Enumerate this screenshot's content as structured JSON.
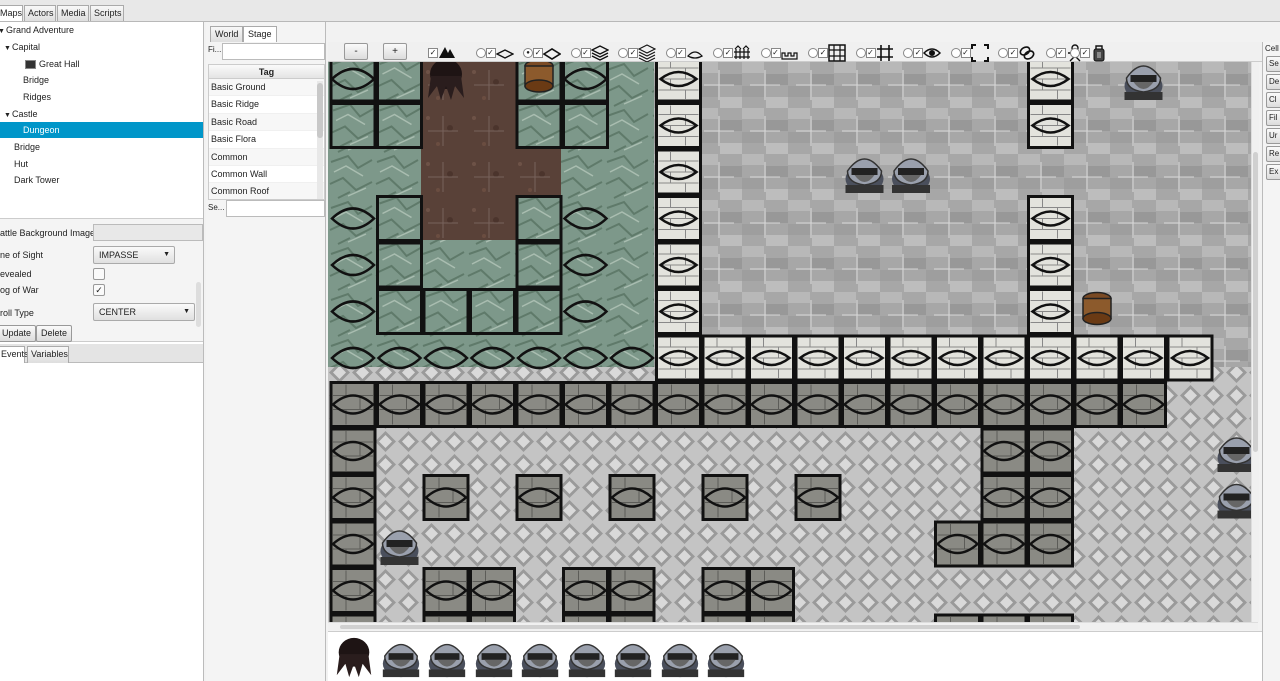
{
  "top_tabs": [
    {
      "label": "Maps",
      "active": true
    },
    {
      "label": "Actors",
      "active": false
    },
    {
      "label": "Media",
      "active": false
    },
    {
      "label": "Scripts",
      "active": false
    }
  ],
  "tree": {
    "root": "Grand Adventure",
    "items": [
      {
        "label": "Capital",
        "expandable": true,
        "expanded": true
      },
      {
        "label": "Great Hall",
        "icon": "map-thumbnail-icon"
      },
      {
        "label": "Bridge"
      },
      {
        "label": "Ridges"
      },
      {
        "label": "Castle",
        "expandable": true,
        "expanded": true
      },
      {
        "label": "Dungeon",
        "selected": true
      },
      {
        "label": "Bridge"
      },
      {
        "label": "Hut"
      },
      {
        "label": "Dark Tower"
      }
    ]
  },
  "properties": {
    "battle_background_label": "attle Background Image",
    "battle_background_value": "",
    "line_of_sight_label": "ne of Sight",
    "line_of_sight_value": "IMPASSE",
    "revealed_label": "evealed",
    "revealed_checked": false,
    "fog_of_war_label": "og of War",
    "fog_of_war_checked": true,
    "scroll_type_label": "roll Type",
    "scroll_type_value": "CENTER",
    "update_button": "Update",
    "delete_button": "Delete"
  },
  "bottom_tabs": [
    {
      "label": "Events",
      "active": true
    },
    {
      "label": "Variables",
      "active": false
    }
  ],
  "sub_tabs": [
    {
      "label": "World",
      "active": false
    },
    {
      "label": "Stage",
      "active": true
    }
  ],
  "tag_panel": {
    "filter_label": "Fi...",
    "filter_value": "",
    "header": "Tag",
    "rows": [
      "Basic Ground",
      "Basic Ridge",
      "Basic Road",
      "Basic Flora",
      "Common",
      "Common Wall",
      "Common Roof"
    ],
    "search_label": "Se...",
    "search_value": ""
  },
  "toolbar": {
    "zoom_out": "-",
    "zoom_in": "+",
    "tools": [
      {
        "name": "mountain-layer-icon",
        "checked": true,
        "radio": false
      },
      {
        "name": "ground-layer-icon",
        "checked": true,
        "radio": false
      },
      {
        "name": "flat-tile-layer-icon",
        "checked": true,
        "radio": true
      },
      {
        "name": "stack-layer-icon",
        "checked": true,
        "radio": false
      },
      {
        "name": "multi-stack-layer-icon",
        "checked": true,
        "radio": false
      },
      {
        "name": "shape-layer-icon",
        "checked": true,
        "radio": false
      },
      {
        "name": "fence-layer-icon",
        "checked": true,
        "radio": false
      },
      {
        "name": "crenellation-layer-icon",
        "checked": true,
        "radio": false
      },
      {
        "name": "grid-cells-icon",
        "checked": true,
        "radio": false
      },
      {
        "name": "grid-lines-icon",
        "checked": true,
        "radio": false
      },
      {
        "name": "eye-icon",
        "checked": true,
        "radio": false
      },
      {
        "name": "selection-frame-icon",
        "checked": true,
        "radio": false
      },
      {
        "name": "link-icon",
        "checked": true,
        "radio": false
      },
      {
        "name": "actor-icon",
        "checked": true,
        "radio": false
      },
      {
        "name": "lantern-icon",
        "checked": true,
        "radio": false
      }
    ]
  },
  "right_panel": {
    "label": "Cell",
    "buttons": [
      "Se",
      "De",
      "Cl",
      "Fil",
      "Ur",
      "Re",
      "Ex"
    ]
  },
  "palette": [
    {
      "name": "hair-sprite-icon"
    },
    {
      "name": "knight-sprite-icon"
    },
    {
      "name": "knight-sprite-icon"
    },
    {
      "name": "knight-sprite-icon"
    },
    {
      "name": "knight-sprite-icon"
    },
    {
      "name": "knight-sprite-icon"
    },
    {
      "name": "knight-sprite-icon"
    },
    {
      "name": "knight-sprite-icon"
    },
    {
      "name": "knight-sprite-icon"
    }
  ],
  "colors": {
    "selection": "#0096c9",
    "grass": "#7f9a86",
    "dirt": "#5a4238",
    "marble": "#a8a8a8",
    "cobble": "#b9b9b9"
  }
}
